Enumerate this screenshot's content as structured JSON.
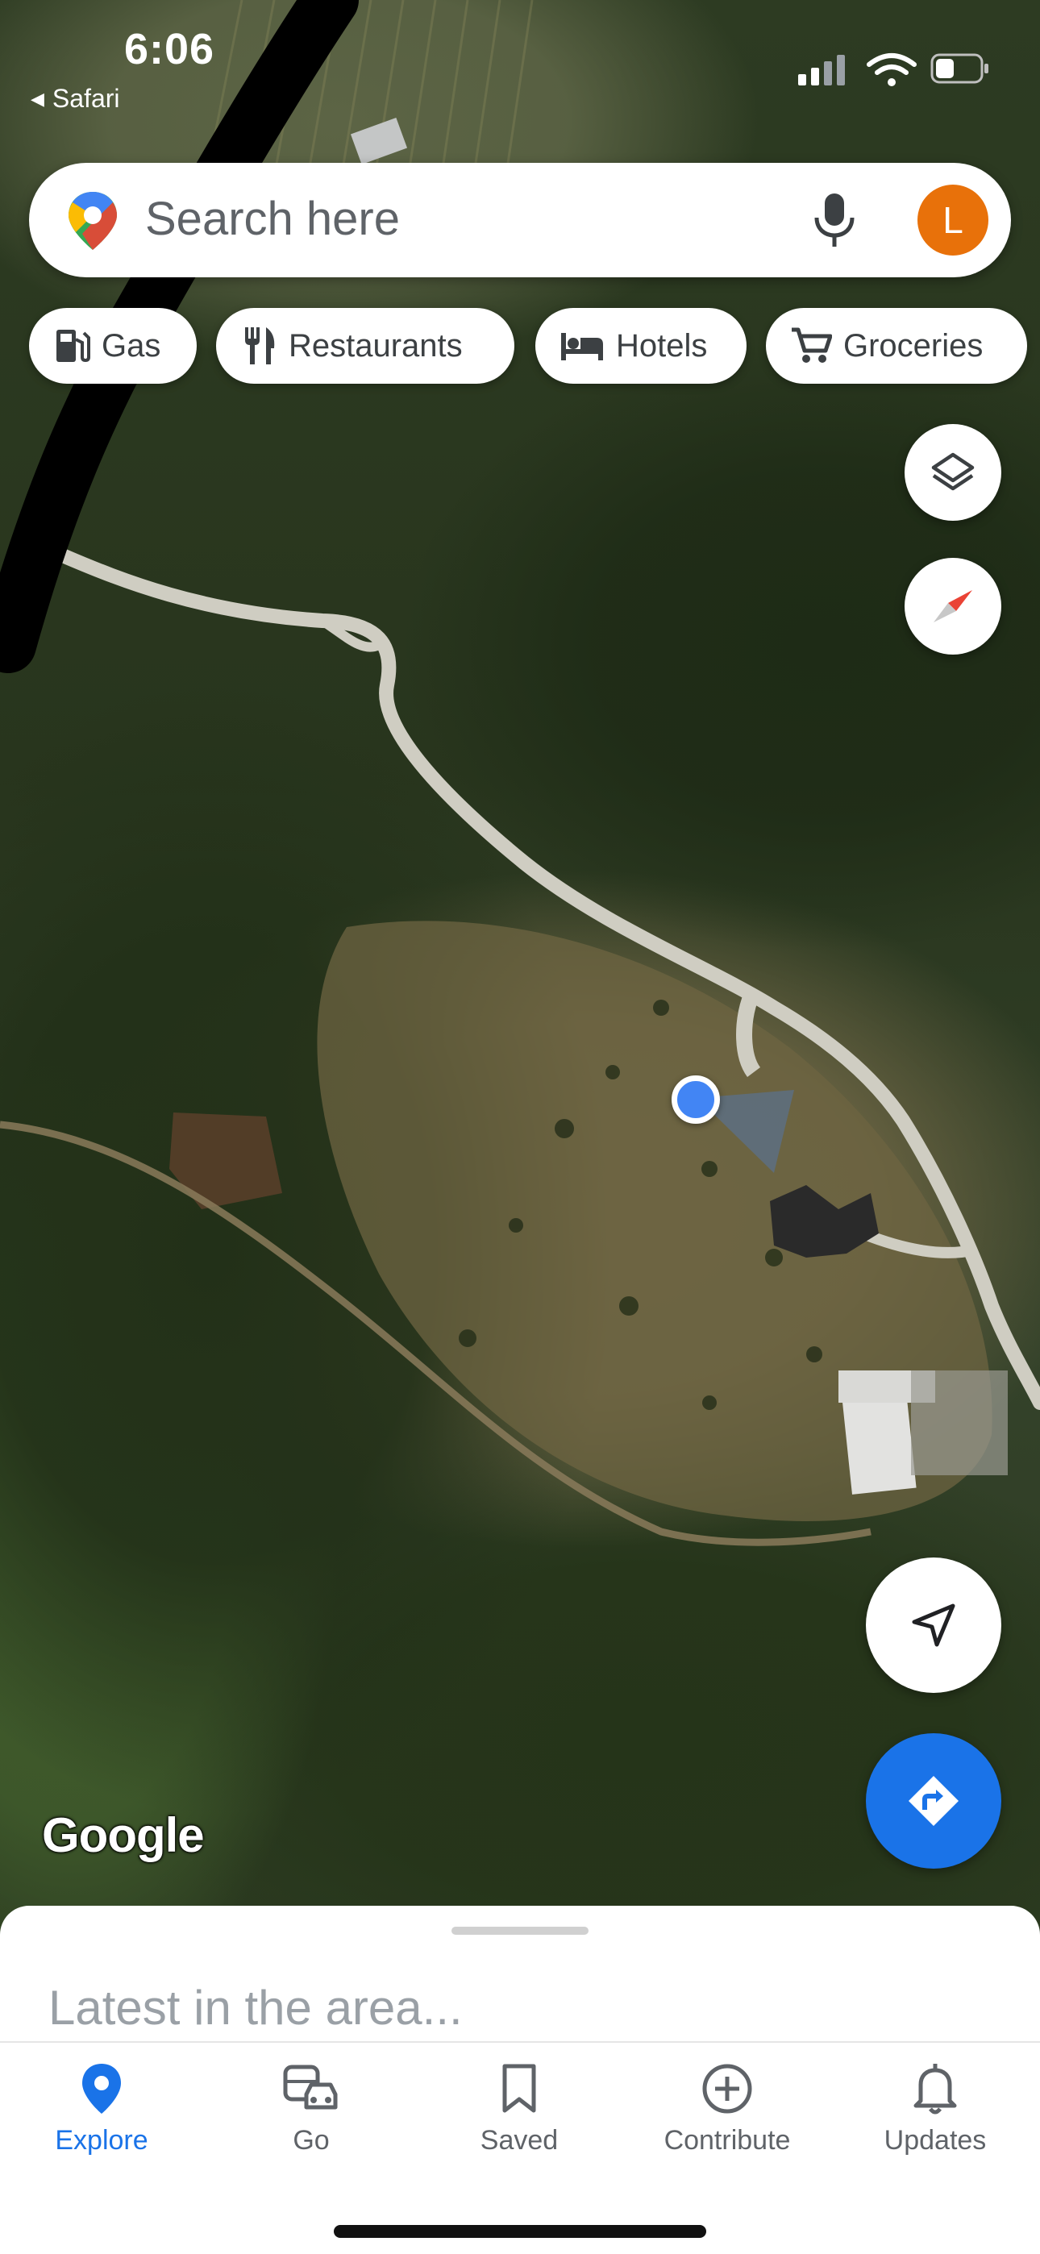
{
  "status_bar": {
    "time": "6:06",
    "back_app": "Safari",
    "icons": [
      "cellular-signal-icon",
      "wifi-icon",
      "battery-icon"
    ]
  },
  "search": {
    "placeholder": "Search here",
    "avatar_letter": "L",
    "avatar_color": "#e8710a"
  },
  "chips": [
    {
      "label": "Gas",
      "icon": "gas-station-icon"
    },
    {
      "label": "Restaurants",
      "icon": "restaurant-icon"
    },
    {
      "label": "Hotels",
      "icon": "hotel-icon"
    },
    {
      "label": "Groceries",
      "icon": "cart-icon"
    }
  ],
  "map": {
    "attribution": "Google",
    "view": "satellite",
    "user_location_color": "#4285f4"
  },
  "map_controls": [
    "layers-icon",
    "compass-icon",
    "my-location-icon",
    "directions-icon"
  ],
  "sheet": {
    "heading": "Latest in the area..."
  },
  "nav": {
    "active": "Explore",
    "items": [
      {
        "label": "Explore",
        "icon": "explore-pin-icon"
      },
      {
        "label": "Go",
        "icon": "commute-icon"
      },
      {
        "label": "Saved",
        "icon": "bookmark-icon"
      },
      {
        "label": "Contribute",
        "icon": "add-circle-icon"
      },
      {
        "label": "Updates",
        "icon": "bell-icon"
      }
    ]
  },
  "colors": {
    "accent_blue": "#1a73e8",
    "chip_text": "#3c4043"
  }
}
